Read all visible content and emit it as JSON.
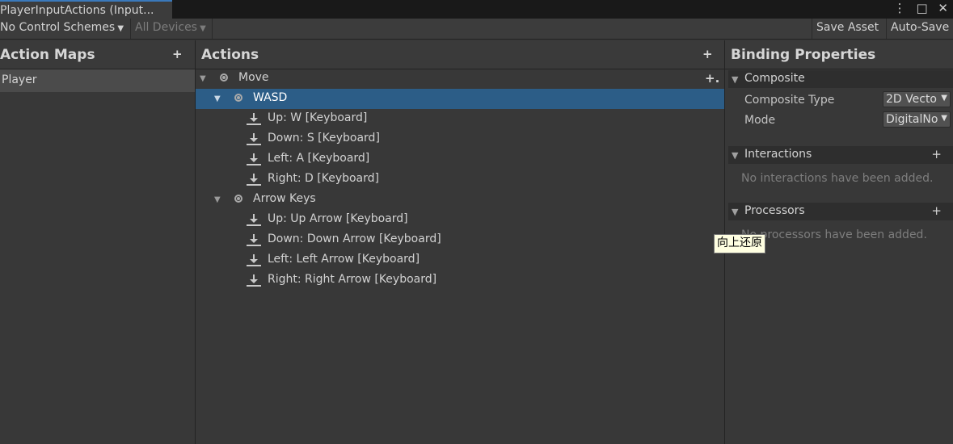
{
  "tab": {
    "title": "PlayerInputActions (Input..."
  },
  "window_controls": {
    "menu": "⋮",
    "maximize": "□",
    "close": "✕"
  },
  "toolbar": {
    "control_schemes": "No Control Schemes",
    "devices": "All Devices",
    "save_asset": "Save Asset",
    "auto_save": "Auto-Save"
  },
  "action_maps": {
    "title": "Action Maps",
    "add": "+",
    "items": [
      {
        "label": "Player"
      }
    ]
  },
  "actions": {
    "title": "Actions",
    "add": "+",
    "row_add": "+.",
    "rows": [
      {
        "label": "Move",
        "kind": "action"
      },
      {
        "label": "WASD",
        "kind": "composite",
        "selected": true
      },
      {
        "label": "Up: W [Keyboard]",
        "kind": "binding"
      },
      {
        "label": "Down: S [Keyboard]",
        "kind": "binding"
      },
      {
        "label": "Left: A [Keyboard]",
        "kind": "binding"
      },
      {
        "label": "Right: D [Keyboard]",
        "kind": "binding"
      },
      {
        "label": "Arrow Keys",
        "kind": "composite"
      },
      {
        "label": "Up: Up Arrow [Keyboard]",
        "kind": "binding"
      },
      {
        "label": "Down: Down Arrow [Keyboard]",
        "kind": "binding"
      },
      {
        "label": "Left: Left Arrow [Keyboard]",
        "kind": "binding"
      },
      {
        "label": "Right: Right Arrow [Keyboard]",
        "kind": "binding"
      }
    ]
  },
  "binding_properties": {
    "title": "Binding Properties",
    "composite": {
      "header": "Composite",
      "composite_type_label": "Composite Type",
      "composite_type_value": "2D Vecto",
      "mode_label": "Mode",
      "mode_value": "DigitalNo"
    },
    "interactions": {
      "header": "Interactions",
      "add": "+",
      "empty": "No interactions have been added."
    },
    "processors": {
      "header": "Processors",
      "add": "+",
      "empty": "No processors have been added."
    }
  },
  "tooltip": {
    "text": "向上还原"
  },
  "colors": {
    "selection": "#2c5d87",
    "tab_accent": "#3a79bb",
    "tooltip_bg": "#ffffe1"
  }
}
